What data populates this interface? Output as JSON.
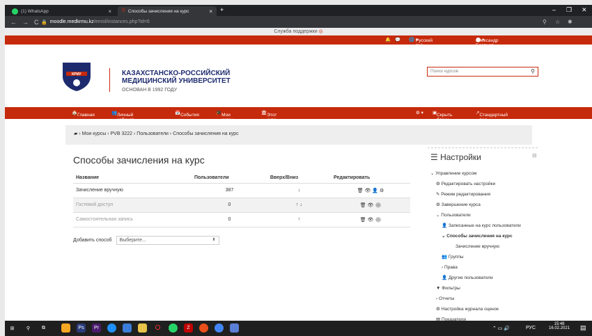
{
  "browser": {
    "tabs": [
      {
        "label": "(1) WhatsApp",
        "close": "×"
      },
      {
        "label": "Способы зачисления на курс",
        "close": "×"
      }
    ],
    "new_tab": "+",
    "url_host": "moodle.medkrmu.kz",
    "url_path": "/enrol/instances.php?id=6"
  },
  "site": {
    "support": "Служба поддержки",
    "language": "Русский (ru)",
    "user": "Александр Бдовцев",
    "university_line1": "КАЗАХСТАНСКО-РОССИЙСКИЙ",
    "university_line2": "МЕДИЦИНСКИЙ УНИВЕРСИТЕТ",
    "founded": "ОСНОВАН   В 1992 ГОДУ",
    "logo_text": "КРМУ",
    "search_placeholder": "Поиск курсов"
  },
  "nav": {
    "home": "Главная",
    "cabinet": "Личный кабинет",
    "events": "События",
    "mycourses": "Мои курсы",
    "thiscourse": "Этот курс",
    "hide_blocks": "Скрыть блоки",
    "standard_view": "Стандартный вид"
  },
  "breadcrumb": [
    "Мои курсы",
    "PVB 3222",
    "Пользователи",
    "Способы зачисления на курс"
  ],
  "page": {
    "title": "Способы зачисления на курс",
    "columns": [
      "Название",
      "Пользователи",
      "Вверх/Вниз",
      "Редактировать"
    ],
    "rows": [
      {
        "name": "Зачисление вручную",
        "users": "387",
        "updown": "↓",
        "edit": "🗑 👁 👤 ⚙"
      },
      {
        "name": "Гостевой доступ",
        "users": "0",
        "updown": "↑ ↓",
        "edit": "🗑 👁 ⚙"
      },
      {
        "name": "Самостоятельная запись",
        "users": "0",
        "updown": "↑",
        "edit": "🗑 👁 ⚙"
      }
    ],
    "add_label": "Добавить способ",
    "add_select": "Выберите..."
  },
  "settings": {
    "title": "Настройки",
    "items": [
      "Управление курсом",
      "Редактировать настройки",
      "Режим редактирования",
      "Завершение курса",
      "Пользователи",
      "Записанные на курс пользователи",
      "Способы зачисления на курс",
      "Зачисление вручную",
      "Группы",
      "Права",
      "Другие пользователи",
      "Фильтры",
      "Отчеты",
      "Настройка журнала оценок",
      "Показатели"
    ]
  },
  "taskbar": {
    "lang": "РУС",
    "time": "15:48",
    "date": "16.02.2021"
  },
  "colors": {
    "brand": "#c62a0c",
    "navy": "#1d2b6e"
  }
}
